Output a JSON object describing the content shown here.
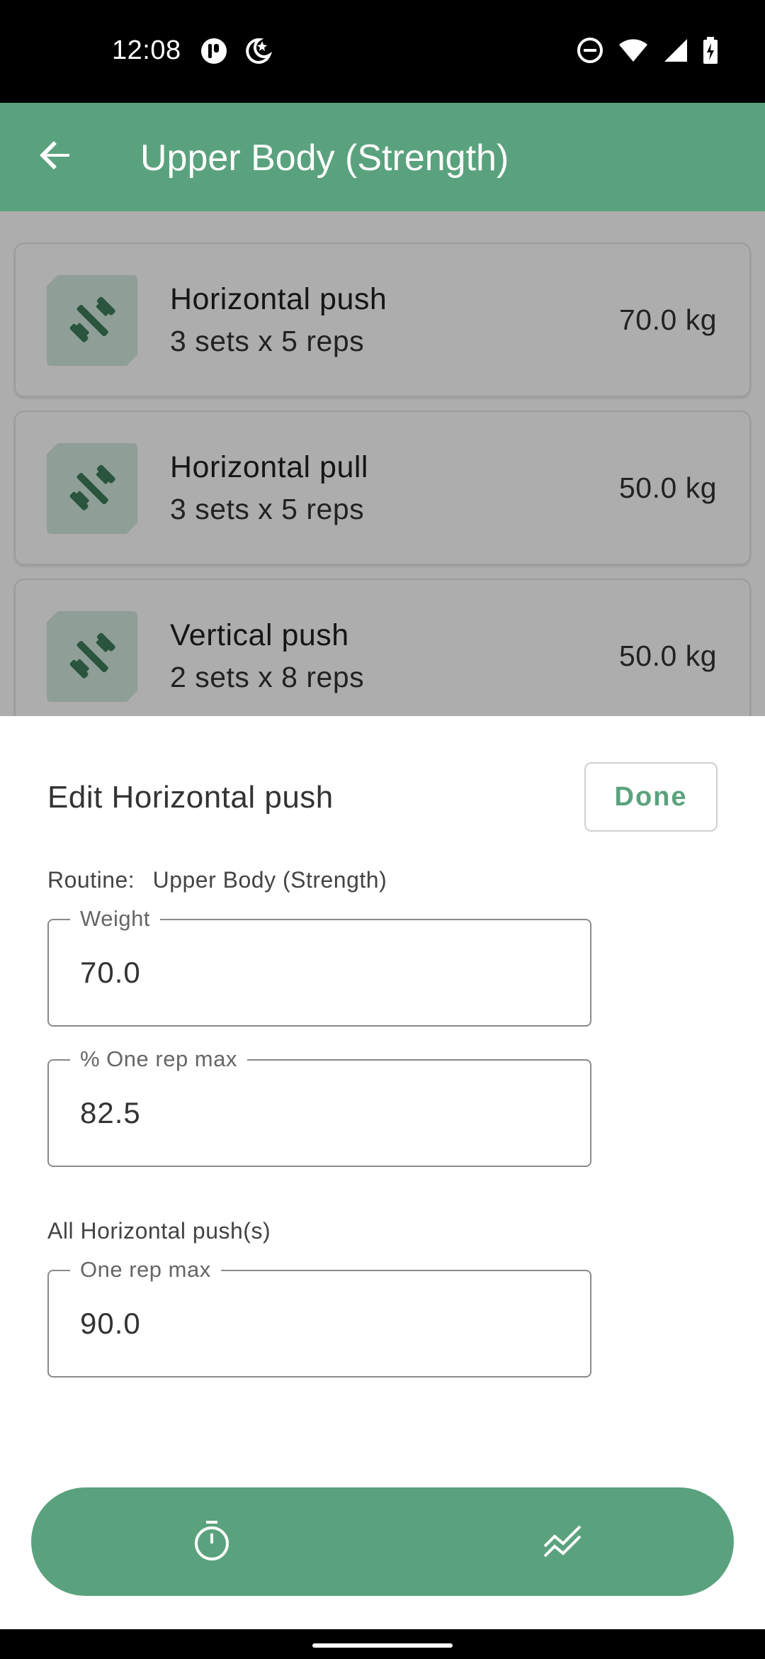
{
  "status_bar": {
    "time": "12:08",
    "left_icons": [
      "app-notification-icon",
      "do-not-disturb-moon-icon"
    ],
    "right_icons": [
      "dnd-icon",
      "wifi-icon",
      "signal-icon",
      "battery-charging-icon"
    ]
  },
  "app_bar": {
    "back_icon": "arrow-back-icon",
    "title": "Upper Body (Strength)"
  },
  "exercises": [
    {
      "icon": "dumbbell-icon",
      "name": "Horizontal push",
      "sets": "3 sets x 5 reps",
      "weight": "70.0 kg"
    },
    {
      "icon": "dumbbell-icon",
      "name": "Horizontal pull",
      "sets": "3 sets x 5 reps",
      "weight": "50.0 kg"
    },
    {
      "icon": "dumbbell-icon",
      "name": "Vertical push",
      "sets": "2 sets x 8 reps",
      "weight": "50.0 kg"
    }
  ],
  "sheet": {
    "title": "Edit Horizontal push",
    "done_label": "Done",
    "routine_label": "Routine:",
    "routine_value": "Upper Body (Strength)",
    "fields": {
      "weight": {
        "label": "Weight",
        "value": "70.0"
      },
      "percent_orm": {
        "label": "% One rep max",
        "value": "82.5"
      },
      "one_rep_max": {
        "label": "One rep max",
        "value": "90.0"
      }
    },
    "all_section_label": "All Horizontal push(s)"
  },
  "bottom_nav": {
    "items": [
      {
        "icon": "timer-icon"
      },
      {
        "icon": "stats-chart-icon"
      }
    ]
  },
  "colors": {
    "primary": "#5aa27d",
    "thumb_bg": "#d3e9dd",
    "icon_dark": "#3e7d5b"
  }
}
